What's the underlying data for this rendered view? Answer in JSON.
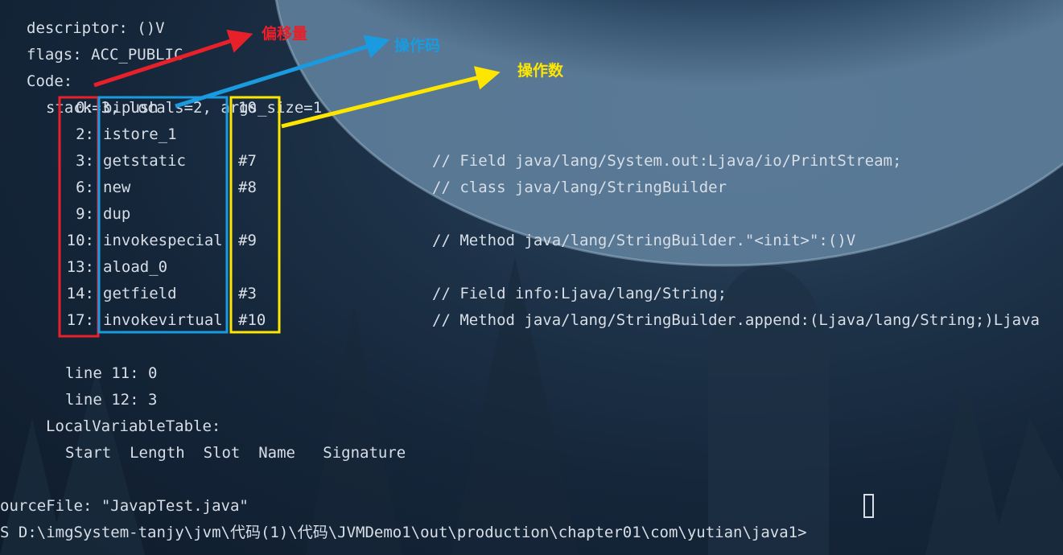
{
  "header": {
    "descriptor": "descriptor: ()V",
    "flags": "flags: ACC_PUBLIC",
    "code": "Code:",
    "stack": "stack=3, locals=2, args_size=1"
  },
  "instructions": [
    {
      "offset": "0:",
      "opcode": "bipush",
      "operand": "10",
      "comment": ""
    },
    {
      "offset": "2:",
      "opcode": "istore_1",
      "operand": "",
      "comment": ""
    },
    {
      "offset": "3:",
      "opcode": "getstatic",
      "operand": "#7",
      "comment": "// Field java/lang/System.out:Ljava/io/PrintStream;"
    },
    {
      "offset": "6:",
      "opcode": "new",
      "operand": "#8",
      "comment": "// class java/lang/StringBuilder"
    },
    {
      "offset": "9:",
      "opcode": "dup",
      "operand": "",
      "comment": ""
    },
    {
      "offset": "10:",
      "opcode": "invokespecial",
      "operand": "#9",
      "comment": "// Method java/lang/StringBuilder.\"<init>\":()V"
    },
    {
      "offset": "13:",
      "opcode": "aload_0",
      "operand": "",
      "comment": ""
    },
    {
      "offset": "14:",
      "opcode": "getfield",
      "operand": "#3",
      "comment": "// Field info:Ljava/lang/String;"
    },
    {
      "offset": "17:",
      "opcode": "invokevirtual",
      "operand": "#10",
      "comment": "// Method java/lang/StringBuilder.append:(Ljava/lang/String;)Ljava"
    }
  ],
  "line_numbers": [
    "line 11: 0",
    "line 12: 3"
  ],
  "local_variable_table": {
    "title": "LocalVariableTable:",
    "columns": "Start  Length  Slot  Name   Signature"
  },
  "source_file": "ourceFile: \"JavapTest.java\"",
  "prompt": "S D:\\imgSystem-tanjy\\jvm\\代码(1)\\代码\\JVMDemo1\\out\\production\\chapter01\\com\\yutian\\java1>",
  "annotations": {
    "offset_label": "偏移量",
    "opcode_label": "操作码",
    "operand_label": "操作数"
  },
  "colors": {
    "offset": "#e8202a",
    "opcode": "#1a9be0",
    "operand": "#ffe600",
    "text": "#d8dee6"
  }
}
